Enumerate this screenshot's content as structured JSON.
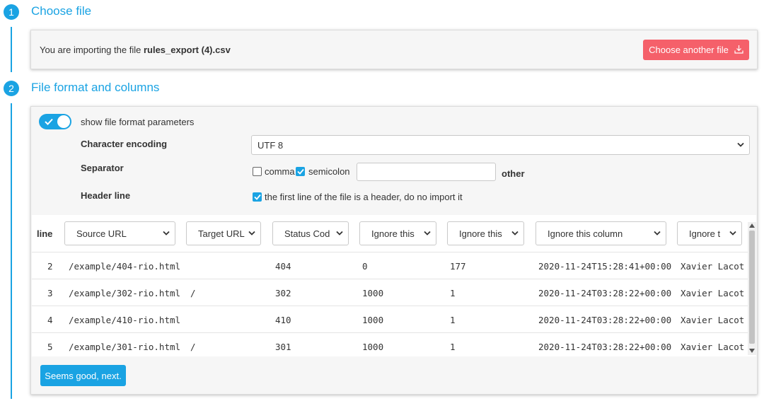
{
  "steps": [
    {
      "number": "1",
      "title": "Choose file"
    },
    {
      "number": "2",
      "title": "File format and columns"
    }
  ],
  "file_panel": {
    "prefix": "You are importing the file",
    "filename": "rules_export (4).csv",
    "choose_another_label": "Choose another file",
    "choose_another_icon": "download-icon",
    "button_color": "#f5606a"
  },
  "format_panel": {
    "toggle_label": "show file format parameters",
    "toggle_on": true,
    "encoding": {
      "label": "Character encoding",
      "value": "UTF 8"
    },
    "separator": {
      "label": "Separator",
      "options": [
        {
          "label": "comma",
          "checked": false
        },
        {
          "label": "semicolon",
          "checked": true
        }
      ],
      "other_value": "",
      "other_label": "other"
    },
    "header_line": {
      "label": "Header line",
      "checked": true,
      "text": "the first line of the file is a header, do no import it"
    }
  },
  "table": {
    "line_header": "line",
    "columns": [
      "Source URL",
      "Target URL",
      "Status Code",
      "Ignore this",
      "Ignore this",
      "Ignore this column",
      "Ignore t"
    ],
    "rows": [
      {
        "line": "2",
        "cells": [
          "/example/404-rio.html",
          "",
          "404",
          "0",
          "177",
          "2020-11-24T15:28:41+00:00",
          "Xavier Lacot"
        ]
      },
      {
        "line": "3",
        "cells": [
          "/example/302-rio.html",
          "/",
          "302",
          "1000",
          "1",
          "2020-11-24T03:28:22+00:00",
          "Xavier Lacot"
        ]
      },
      {
        "line": "4",
        "cells": [
          "/example/410-rio.html",
          "",
          "410",
          "1000",
          "1",
          "2020-11-24T03:28:22+00:00",
          "Xavier Lacot"
        ]
      },
      {
        "line": "5",
        "cells": [
          "/example/301-rio.html",
          "/",
          "301",
          "1000",
          "1",
          "2020-11-24T03:28:22+00:00",
          "Xavier Lacot"
        ]
      }
    ]
  },
  "next_button": {
    "label": "Seems good, next.",
    "color": "#1aa3e3"
  },
  "accent_color": "#1aa3e3"
}
